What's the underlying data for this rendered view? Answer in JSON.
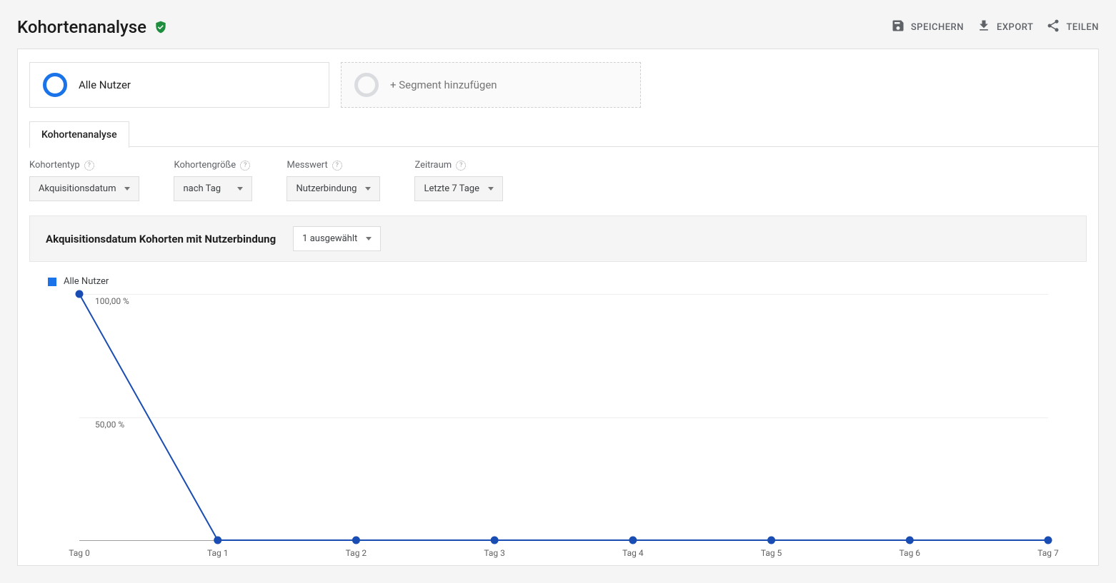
{
  "header": {
    "title": "Kohortenanalyse",
    "actions": {
      "save": "SPEICHERN",
      "export": "EXPORT",
      "share": "TEILEN"
    }
  },
  "segments": {
    "primary_label": "Alle Nutzer",
    "add_label": "+ Segment hinzufügen"
  },
  "tabs": {
    "main": "Kohortenanalyse"
  },
  "controls": {
    "cohort_type": {
      "label": "Kohortentyp",
      "value": "Akquisitionsdatum"
    },
    "cohort_size": {
      "label": "Kohortengröße",
      "value": "nach Tag"
    },
    "metric": {
      "label": "Messwert",
      "value": "Nutzerbindung"
    },
    "range": {
      "label": "Zeitraum",
      "value": "Letzte 7 Tage"
    }
  },
  "chart": {
    "title": "Akquisitionsdatum Kohorten mit Nutzerbindung",
    "selector_label": "1 ausgewählt",
    "legend": "Alle Nutzer"
  },
  "chart_data": {
    "type": "line",
    "categories": [
      "Tag 0",
      "Tag 1",
      "Tag 2",
      "Tag 3",
      "Tag 4",
      "Tag 5",
      "Tag 6",
      "Tag 7"
    ],
    "series": [
      {
        "name": "Alle Nutzer",
        "values": [
          100,
          0,
          0,
          0,
          0,
          0,
          0,
          0
        ]
      }
    ],
    "ylabels": [
      "100,00 %",
      "50,00 %"
    ],
    "ylim": [
      0,
      100
    ],
    "xlabel": "",
    "ylabel": ""
  },
  "colors": {
    "accent": "#1a73e8",
    "line": "#1a4db3"
  }
}
